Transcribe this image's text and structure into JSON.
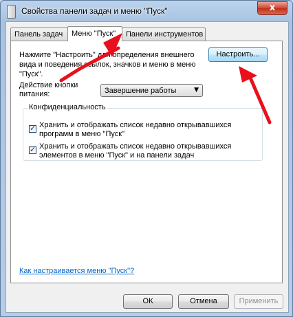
{
  "window": {
    "title": "Свойства панели задач и меню \"Пуск\"",
    "close_symbol": "x"
  },
  "tabs": [
    {
      "label": "Панель задач",
      "active": false
    },
    {
      "label": "Меню \"Пуск\"",
      "active": true
    },
    {
      "label": "Панели инструментов",
      "active": false
    }
  ],
  "start_menu": {
    "description_line1": "Нажмите \"Настроить\" для определения внешнего",
    "description_line2": "вида и поведения ссылок, значков и меню в меню",
    "description_line3": "\"Пуск\".",
    "customize_button": "Настроить...",
    "power_label_line1": "Действие кнопки",
    "power_label_line2": "питания:",
    "power_value": "Завершение работы",
    "privacy_group_title": "Конфиденциальность",
    "privacy_option1_line1": "Хранить и отображать список недавно открывавшихся",
    "privacy_option1_line2": "программ в меню \"Пуск\"",
    "privacy_option1_checked": true,
    "privacy_option2_line1": "Хранить и отображать список недавно открывавшихся",
    "privacy_option2_line2": "элементов в меню \"Пуск\" и на панели задач",
    "privacy_option2_checked": true,
    "help_link": "Как настраивается меню \"Пуск\"?"
  },
  "buttons": {
    "ok": "ОК",
    "cancel": "Отмена",
    "apply": "Применить"
  },
  "colors": {
    "annotation_arrow": "#e8101c",
    "link": "#0066cc",
    "title_bar": "#a8c3e2",
    "close_button": "#c1301a"
  }
}
